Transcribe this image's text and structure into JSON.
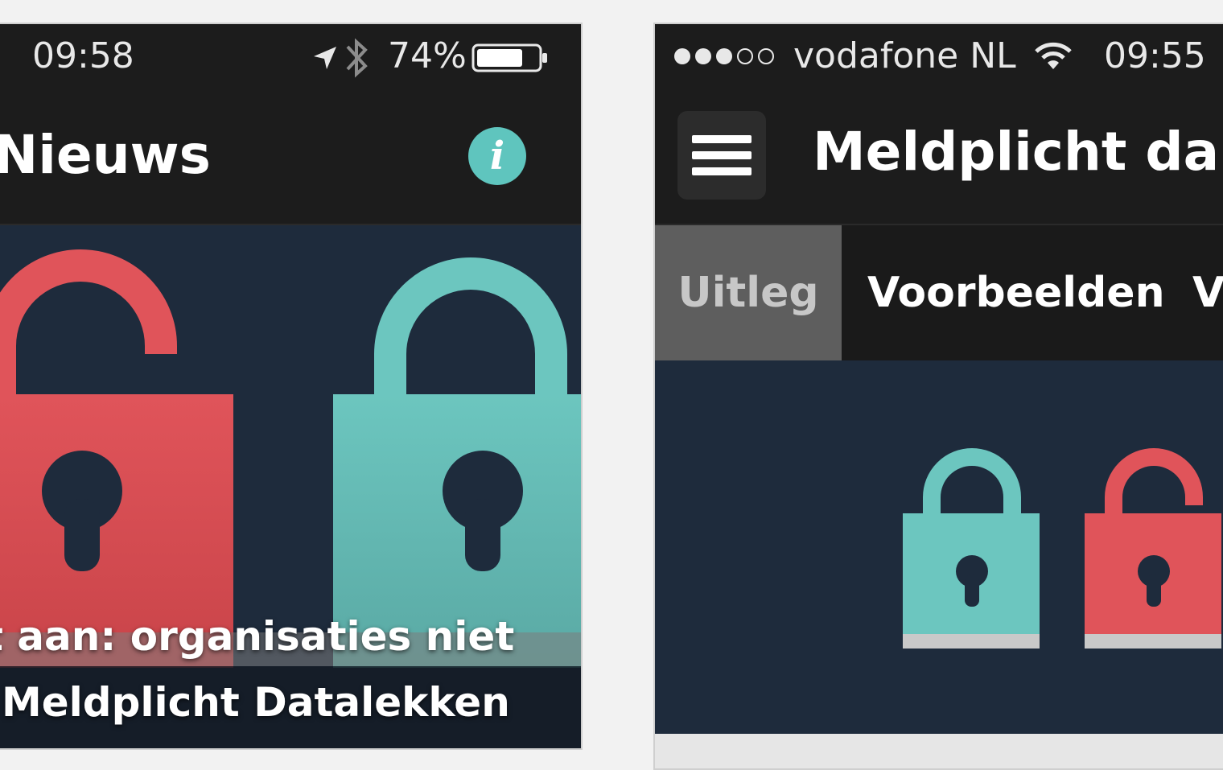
{
  "left_screen": {
    "status_bar": {
      "time": "09:58",
      "battery_percent": "74%"
    },
    "nav": {
      "title": "Nieuws",
      "info_icon": "i"
    },
    "article": {
      "headline_line1": "t aan: organisaties niet",
      "headline_line2": "Meldplicht Datalekken"
    },
    "colors": {
      "lock_red": "#e0545a",
      "lock_teal": "#6cc6bf",
      "info_teal": "#5fc5be",
      "background": "#1e2b3c"
    }
  },
  "right_screen": {
    "status_bar": {
      "carrier": "vodafone NL",
      "time": "09:55"
    },
    "nav": {
      "title": "Meldplicht da"
    },
    "tabs": [
      {
        "label": "Uitleg",
        "active": true
      },
      {
        "label": "Voorbeelden",
        "active": false
      },
      {
        "label": "V",
        "active": false
      }
    ]
  }
}
